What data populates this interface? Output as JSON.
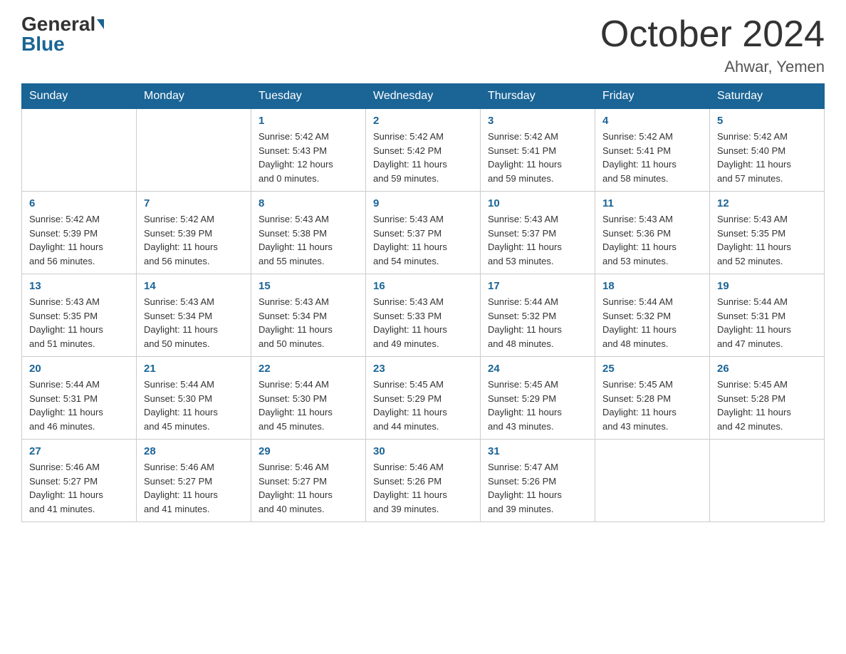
{
  "logo": {
    "general": "General",
    "blue": "Blue"
  },
  "header": {
    "title": "October 2024",
    "location": "Ahwar, Yemen"
  },
  "days_of_week": [
    "Sunday",
    "Monday",
    "Tuesday",
    "Wednesday",
    "Thursday",
    "Friday",
    "Saturday"
  ],
  "weeks": [
    [
      {
        "day": "",
        "info": ""
      },
      {
        "day": "",
        "info": ""
      },
      {
        "day": "1",
        "info": "Sunrise: 5:42 AM\nSunset: 5:43 PM\nDaylight: 12 hours\nand 0 minutes."
      },
      {
        "day": "2",
        "info": "Sunrise: 5:42 AM\nSunset: 5:42 PM\nDaylight: 11 hours\nand 59 minutes."
      },
      {
        "day": "3",
        "info": "Sunrise: 5:42 AM\nSunset: 5:41 PM\nDaylight: 11 hours\nand 59 minutes."
      },
      {
        "day": "4",
        "info": "Sunrise: 5:42 AM\nSunset: 5:41 PM\nDaylight: 11 hours\nand 58 minutes."
      },
      {
        "day": "5",
        "info": "Sunrise: 5:42 AM\nSunset: 5:40 PM\nDaylight: 11 hours\nand 57 minutes."
      }
    ],
    [
      {
        "day": "6",
        "info": "Sunrise: 5:42 AM\nSunset: 5:39 PM\nDaylight: 11 hours\nand 56 minutes."
      },
      {
        "day": "7",
        "info": "Sunrise: 5:42 AM\nSunset: 5:39 PM\nDaylight: 11 hours\nand 56 minutes."
      },
      {
        "day": "8",
        "info": "Sunrise: 5:43 AM\nSunset: 5:38 PM\nDaylight: 11 hours\nand 55 minutes."
      },
      {
        "day": "9",
        "info": "Sunrise: 5:43 AM\nSunset: 5:37 PM\nDaylight: 11 hours\nand 54 minutes."
      },
      {
        "day": "10",
        "info": "Sunrise: 5:43 AM\nSunset: 5:37 PM\nDaylight: 11 hours\nand 53 minutes."
      },
      {
        "day": "11",
        "info": "Sunrise: 5:43 AM\nSunset: 5:36 PM\nDaylight: 11 hours\nand 53 minutes."
      },
      {
        "day": "12",
        "info": "Sunrise: 5:43 AM\nSunset: 5:35 PM\nDaylight: 11 hours\nand 52 minutes."
      }
    ],
    [
      {
        "day": "13",
        "info": "Sunrise: 5:43 AM\nSunset: 5:35 PM\nDaylight: 11 hours\nand 51 minutes."
      },
      {
        "day": "14",
        "info": "Sunrise: 5:43 AM\nSunset: 5:34 PM\nDaylight: 11 hours\nand 50 minutes."
      },
      {
        "day": "15",
        "info": "Sunrise: 5:43 AM\nSunset: 5:34 PM\nDaylight: 11 hours\nand 50 minutes."
      },
      {
        "day": "16",
        "info": "Sunrise: 5:43 AM\nSunset: 5:33 PM\nDaylight: 11 hours\nand 49 minutes."
      },
      {
        "day": "17",
        "info": "Sunrise: 5:44 AM\nSunset: 5:32 PM\nDaylight: 11 hours\nand 48 minutes."
      },
      {
        "day": "18",
        "info": "Sunrise: 5:44 AM\nSunset: 5:32 PM\nDaylight: 11 hours\nand 48 minutes."
      },
      {
        "day": "19",
        "info": "Sunrise: 5:44 AM\nSunset: 5:31 PM\nDaylight: 11 hours\nand 47 minutes."
      }
    ],
    [
      {
        "day": "20",
        "info": "Sunrise: 5:44 AM\nSunset: 5:31 PM\nDaylight: 11 hours\nand 46 minutes."
      },
      {
        "day": "21",
        "info": "Sunrise: 5:44 AM\nSunset: 5:30 PM\nDaylight: 11 hours\nand 45 minutes."
      },
      {
        "day": "22",
        "info": "Sunrise: 5:44 AM\nSunset: 5:30 PM\nDaylight: 11 hours\nand 45 minutes."
      },
      {
        "day": "23",
        "info": "Sunrise: 5:45 AM\nSunset: 5:29 PM\nDaylight: 11 hours\nand 44 minutes."
      },
      {
        "day": "24",
        "info": "Sunrise: 5:45 AM\nSunset: 5:29 PM\nDaylight: 11 hours\nand 43 minutes."
      },
      {
        "day": "25",
        "info": "Sunrise: 5:45 AM\nSunset: 5:28 PM\nDaylight: 11 hours\nand 43 minutes."
      },
      {
        "day": "26",
        "info": "Sunrise: 5:45 AM\nSunset: 5:28 PM\nDaylight: 11 hours\nand 42 minutes."
      }
    ],
    [
      {
        "day": "27",
        "info": "Sunrise: 5:46 AM\nSunset: 5:27 PM\nDaylight: 11 hours\nand 41 minutes."
      },
      {
        "day": "28",
        "info": "Sunrise: 5:46 AM\nSunset: 5:27 PM\nDaylight: 11 hours\nand 41 minutes."
      },
      {
        "day": "29",
        "info": "Sunrise: 5:46 AM\nSunset: 5:27 PM\nDaylight: 11 hours\nand 40 minutes."
      },
      {
        "day": "30",
        "info": "Sunrise: 5:46 AM\nSunset: 5:26 PM\nDaylight: 11 hours\nand 39 minutes."
      },
      {
        "day": "31",
        "info": "Sunrise: 5:47 AM\nSunset: 5:26 PM\nDaylight: 11 hours\nand 39 minutes."
      },
      {
        "day": "",
        "info": ""
      },
      {
        "day": "",
        "info": ""
      }
    ]
  ]
}
